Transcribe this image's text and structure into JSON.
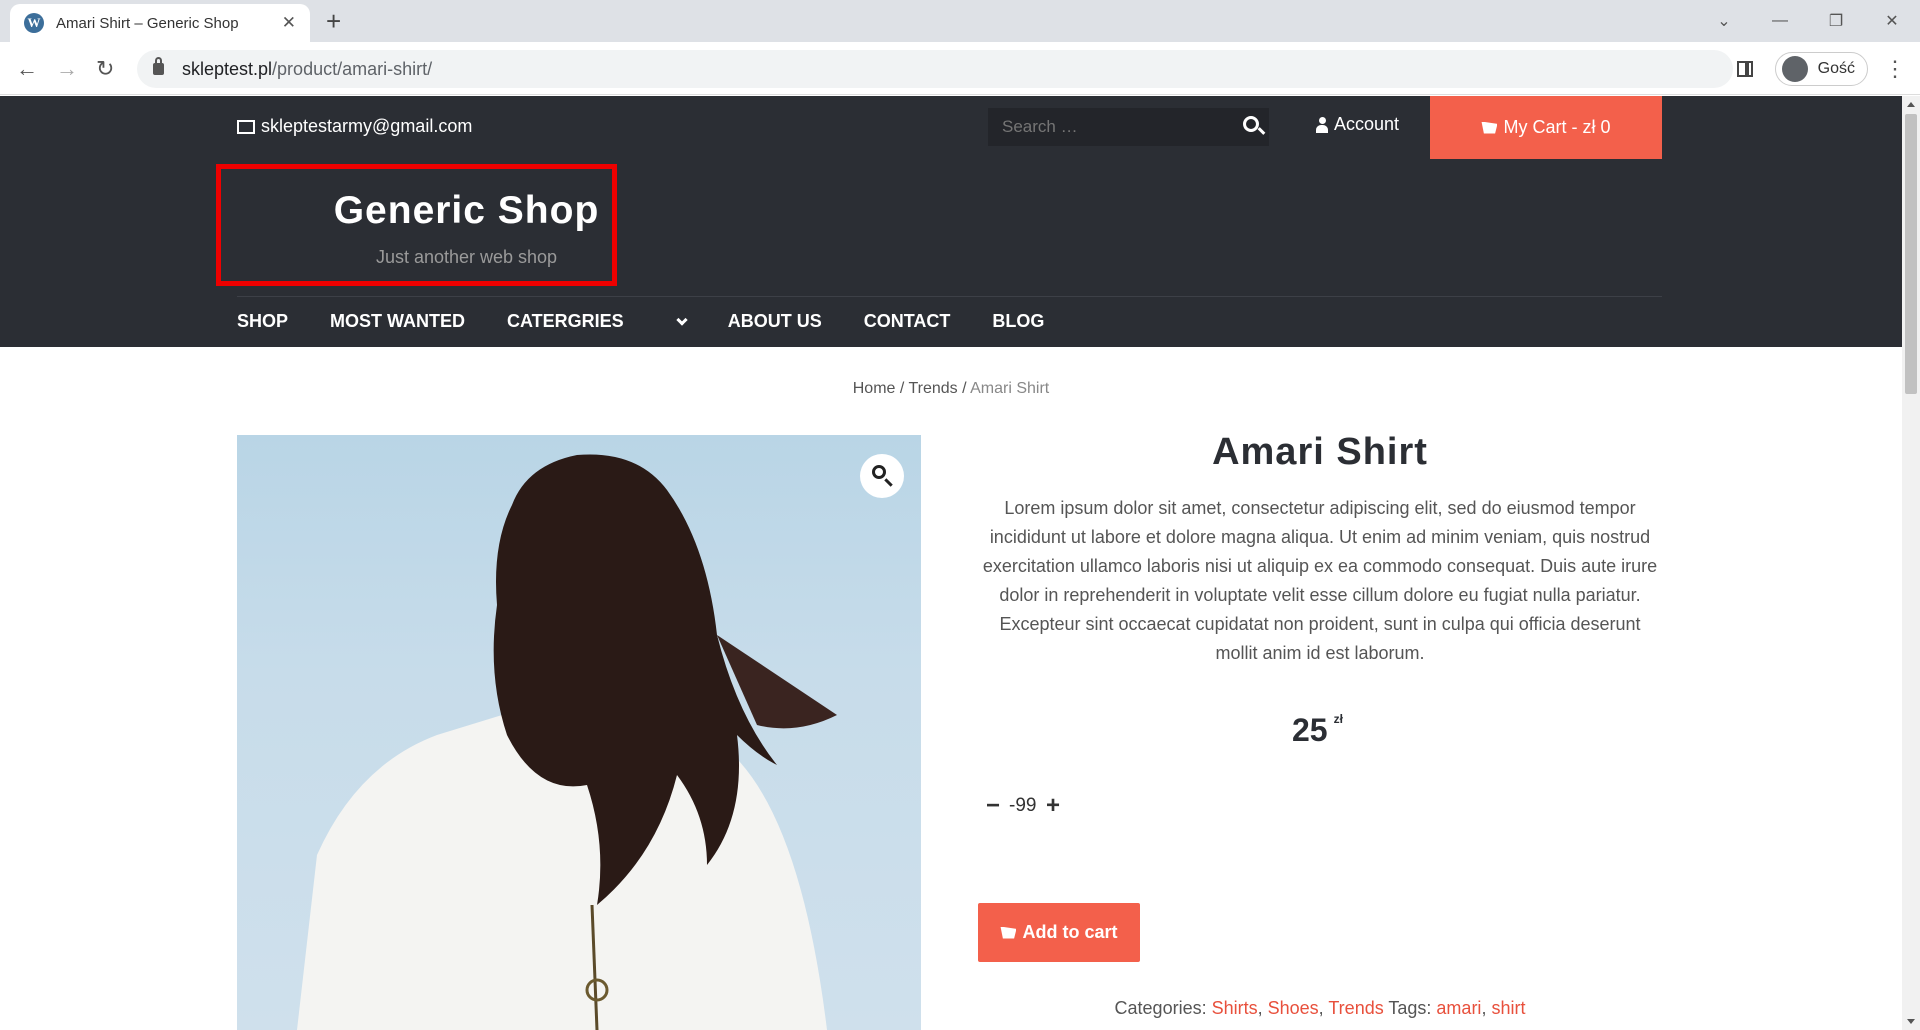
{
  "browser": {
    "tab_title": "Amari Shirt – Generic Shop",
    "url_domain": "skleptest.pl",
    "url_path": "/product/amari-shirt/",
    "profile_name": "Gość"
  },
  "topbar": {
    "email": "skleptestarmy@gmail.com",
    "search_placeholder": "Search …",
    "account_label": "Account",
    "cart_label": "My Cart - zł 0"
  },
  "header": {
    "site_title": "Generic Shop",
    "tagline": "Just another web shop"
  },
  "menu": {
    "items": [
      "SHOP",
      "MOST WANTED",
      "CATERGRIES",
      "ABOUT US",
      "CONTACT",
      "BLOG"
    ]
  },
  "breadcrumb": {
    "home": "Home",
    "sep1": " / ",
    "trends": "Trends",
    "sep2": " / ",
    "current": "Amari Shirt"
  },
  "product": {
    "title": "Amari Shirt",
    "description": "Lorem ipsum dolor sit amet, consectetur adipiscing elit, sed do eiusmod tempor incididunt ut labore et dolore magna aliqua. Ut enim ad minim veniam, quis nostrud exercitation ullamco laboris nisi ut aliquip ex ea commodo consequat. Duis aute irure dolor in reprehenderit in voluptate velit esse cillum dolore eu fugiat nulla pariatur. Excepteur sint occaecat cupidatat non proident, sunt in culpa qui officia deserunt mollit anim id est laborum.",
    "price": "25",
    "currency": "zł",
    "quantity": "-99",
    "minus": "−",
    "plus": "+",
    "add_to_cart": "Add to cart",
    "categories_label": "Categories: ",
    "categories": [
      "Shirts",
      "Shoes",
      "Trends"
    ],
    "tags_label": " Tags: ",
    "tags": [
      "amari",
      "shirt"
    ]
  },
  "colors": {
    "accent": "#f3604b",
    "dark": "#2b2e34",
    "highlight_box": "#e00000"
  }
}
